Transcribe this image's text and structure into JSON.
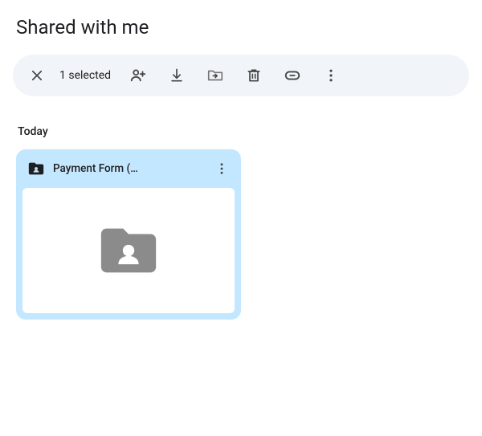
{
  "header": {
    "title": "Shared with me"
  },
  "toolbar": {
    "selected_count_label": "1 selected"
  },
  "section": {
    "label": "Today"
  },
  "files": [
    {
      "name": "Payment Form (…"
    }
  ]
}
